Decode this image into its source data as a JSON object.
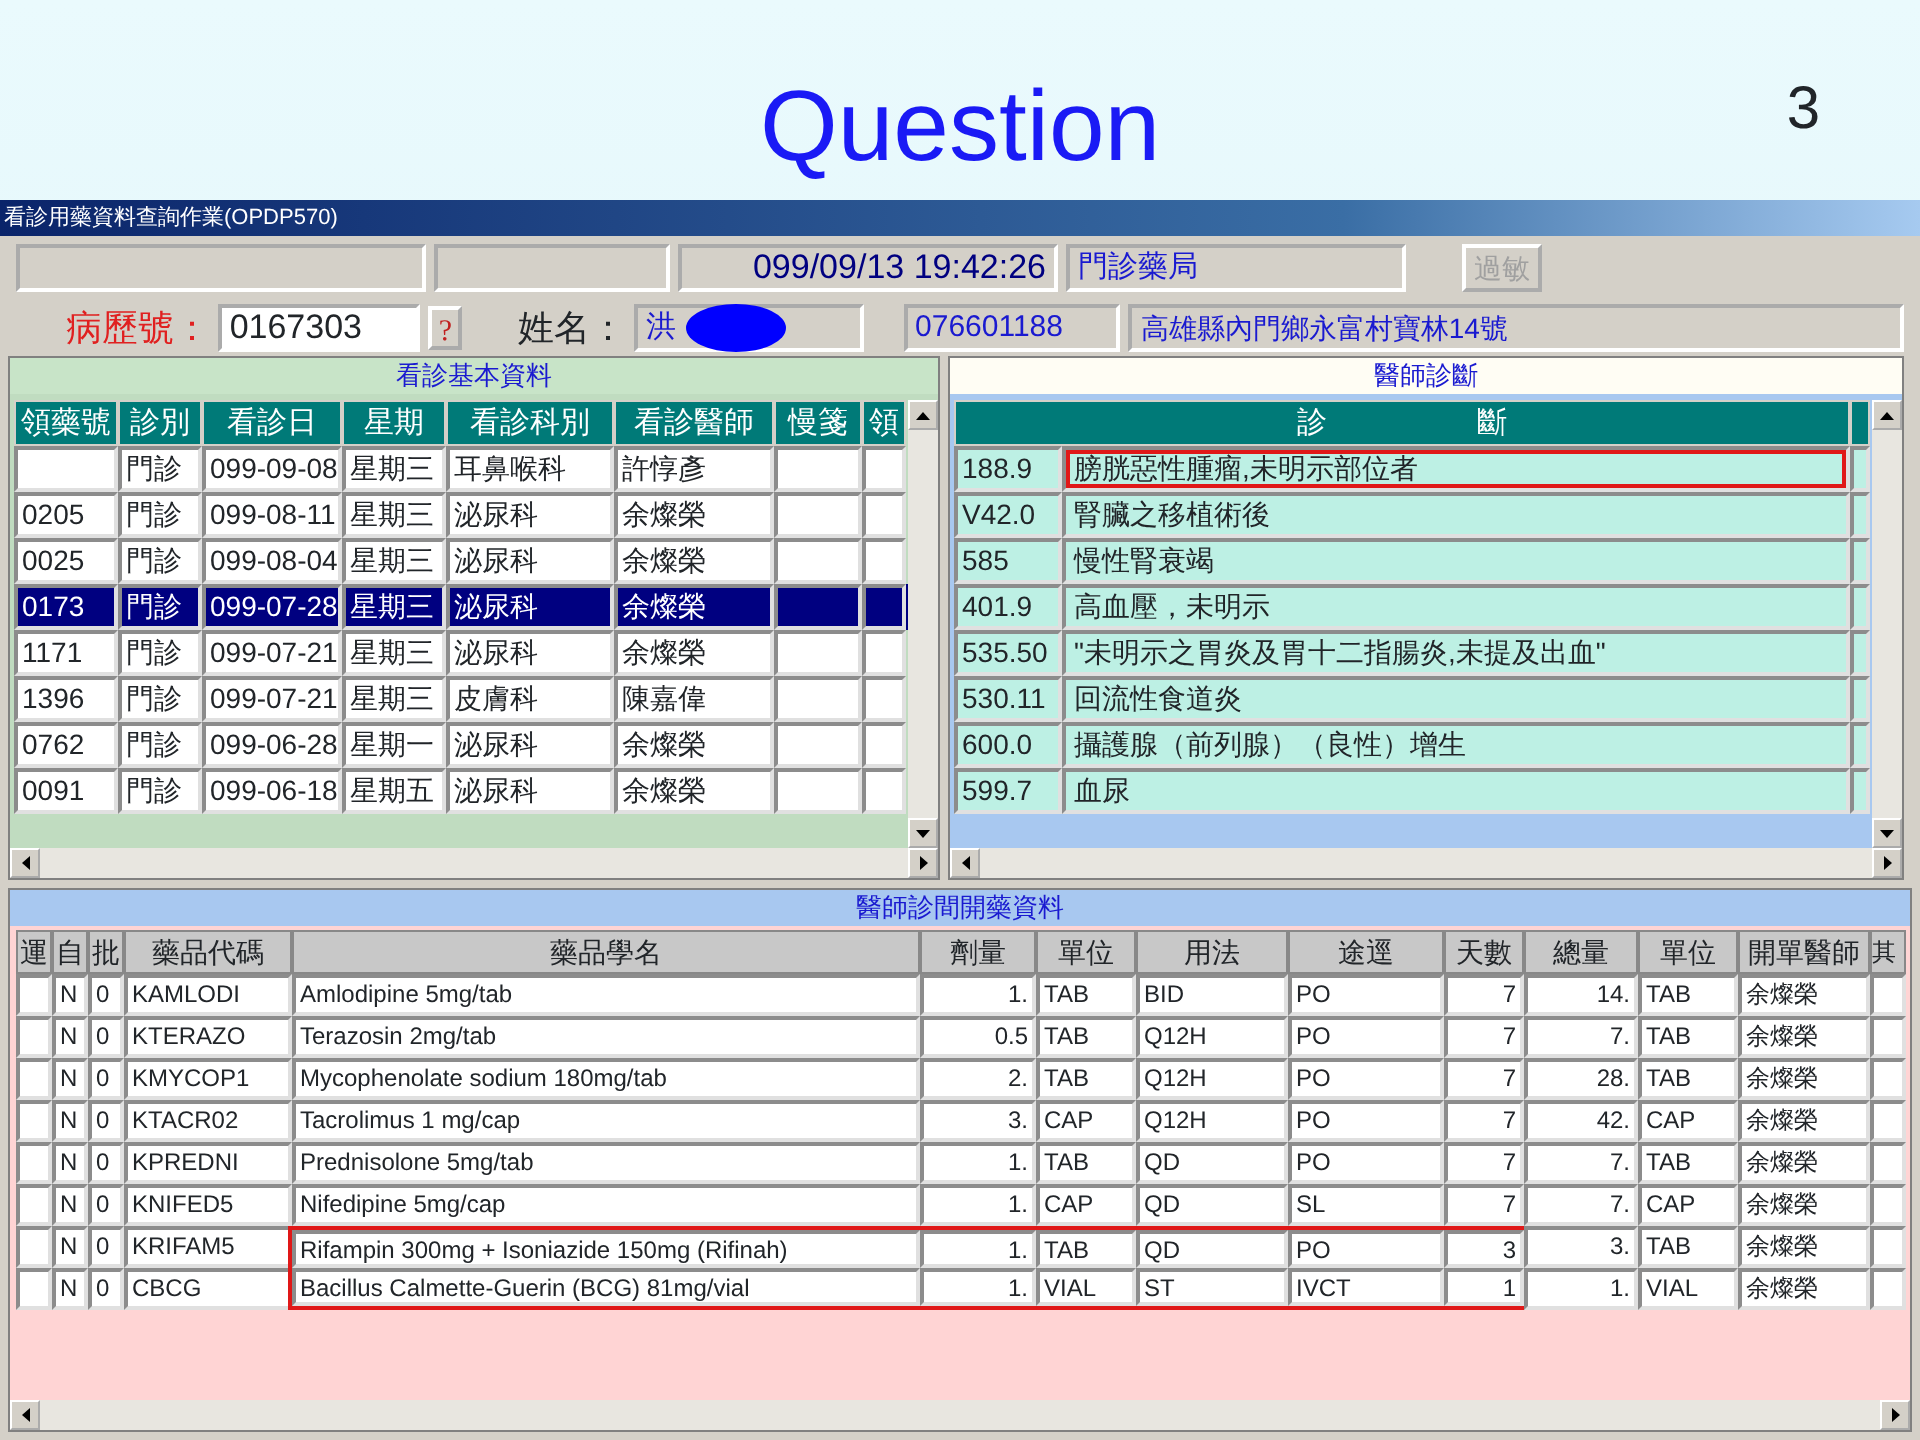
{
  "slide": {
    "title": "Question",
    "page_number": "3"
  },
  "window": {
    "title": "看診用藥資料查詢作業(OPDP570)"
  },
  "toolbar": {
    "datetime": "099/09/13  19:42:26",
    "pharmacy": "門診藥局",
    "allergy_button": {
      "label": "過敏",
      "disabled": true
    }
  },
  "patient": {
    "chart_label": "病歷號：",
    "chart_number": "0167303",
    "lookup_button": "?",
    "name_label": "姓名：",
    "name": "洪",
    "name_redacted": true,
    "phone": "076601188",
    "address": "高雄縣內門鄉永富村寶林14號"
  },
  "visits": {
    "title": "看診基本資料",
    "columns": [
      "領藥號",
      "診別",
      "看診日",
      "星期",
      "看診科別",
      "看診醫師",
      "慢箋",
      "領"
    ],
    "rows": [
      {
        "type": "門診",
        "date": "099-09-08",
        "weekday": "星期三",
        "department": "耳鼻喉科",
        "doctor": "許惇彥",
        "selected": false
      },
      {
        "number": "0205",
        "type": "門診",
        "date": "099-08-11",
        "weekday": "星期三",
        "department": "泌尿科",
        "doctor": "余燦榮",
        "selected": false
      },
      {
        "number": "0025",
        "type": "門診",
        "date": "099-08-04",
        "weekday": "星期三",
        "department": "泌尿科",
        "doctor": "余燦榮",
        "selected": false
      },
      {
        "number": "0173",
        "type": "門診",
        "date": "099-07-28",
        "weekday": "星期三",
        "department": "泌尿科",
        "doctor": "余燦榮",
        "selected": true
      },
      {
        "number": "1171",
        "type": "門診",
        "date": "099-07-21",
        "weekday": "星期三",
        "department": "泌尿科",
        "doctor": "余燦榮",
        "selected": false
      },
      {
        "number": "1396",
        "type": "門診",
        "date": "099-07-21",
        "weekday": "星期三",
        "department": "皮膚科",
        "doctor": "陳嘉偉",
        "selected": false
      },
      {
        "number": "0762",
        "type": "門診",
        "date": "099-06-28",
        "weekday": "星期一",
        "department": "泌尿科",
        "doctor": "余燦榮",
        "selected": false
      },
      {
        "number": "0091",
        "type": "門診",
        "date": "099-06-18",
        "weekday": "星期五",
        "department": "泌尿科",
        "doctor": "余燦榮",
        "selected": false
      }
    ]
  },
  "diagnoses": {
    "title": "醫師診斷",
    "heading": "診　　　　　斷",
    "rows": [
      {
        "code": "188.9",
        "text": "膀胱惡性腫瘤,未明示部位者",
        "highlighted": true
      },
      {
        "code": "V42.0",
        "text": "腎臟之移植術後",
        "highlighted": false
      },
      {
        "code": "585",
        "text": "慢性腎衰竭",
        "highlighted": false
      },
      {
        "code": "401.9",
        "text": "高血壓，未明示",
        "highlighted": false
      },
      {
        "code": "535.50",
        "text": "\"未明示之胃炎及胃十二指腸炎,未提及出血\"",
        "highlighted": false
      },
      {
        "code": "530.11",
        "text": "回流性食道炎",
        "highlighted": false
      },
      {
        "code": "600.0",
        "text": "攝護腺（前列腺）（良性）增生",
        "highlighted": false
      },
      {
        "code": "599.7",
        "text": "血尿",
        "highlighted": false
      }
    ]
  },
  "prescriptions": {
    "title": "醫師診間開藥資料",
    "columns": [
      "運",
      "自",
      "批",
      "藥品代碼",
      "藥品學名",
      "劑量",
      "單位",
      "用法",
      "途逕",
      "天數",
      "總量",
      "單位",
      "開單醫師",
      "其"
    ],
    "rows": [
      {
        "self": "N",
        "batch": "0",
        "code": "KAMLODI",
        "name": "Amlodipine 5mg/tab",
        "dose": "1.",
        "unit": "TAB",
        "usage": "BID",
        "route": "PO",
        "days": "7",
        "total": "14.",
        "total_unit": "TAB",
        "doctor": "余燦榮",
        "highlighted": false
      },
      {
        "self": "N",
        "batch": "0",
        "code": "KTERAZO",
        "name": "Terazosin 2mg/tab",
        "dose": "0.5",
        "unit": "TAB",
        "usage": "Q12H",
        "route": "PO",
        "days": "7",
        "total": "7.",
        "total_unit": "TAB",
        "doctor": "余燦榮",
        "highlighted": false
      },
      {
        "self": "N",
        "batch": "0",
        "code": "KMYCOP1",
        "name": "Mycophenolate sodium 180mg/tab",
        "dose": "2.",
        "unit": "TAB",
        "usage": "Q12H",
        "route": "PO",
        "days": "7",
        "total": "28.",
        "total_unit": "TAB",
        "doctor": "余燦榮",
        "highlighted": false
      },
      {
        "self": "N",
        "batch": "0",
        "code": "KTACR02",
        "name": "Tacrolimus 1 mg/cap",
        "dose": "3.",
        "unit": "CAP",
        "usage": "Q12H",
        "route": "PO",
        "days": "7",
        "total": "42.",
        "total_unit": "CAP",
        "doctor": "余燦榮",
        "highlighted": false
      },
      {
        "self": "N",
        "batch": "0",
        "code": "KPREDNI",
        "name": "Prednisolone 5mg/tab",
        "dose": "1.",
        "unit": "TAB",
        "usage": "QD",
        "route": "PO",
        "days": "7",
        "total": "7.",
        "total_unit": "TAB",
        "doctor": "余燦榮",
        "highlighted": false
      },
      {
        "self": "N",
        "batch": "0",
        "code": "KNIFED5",
        "name": "Nifedipine 5mg/cap",
        "dose": "1.",
        "unit": "CAP",
        "usage": "QD",
        "route": "SL",
        "days": "7",
        "total": "7.",
        "total_unit": "CAP",
        "doctor": "余燦榮",
        "highlighted": false
      },
      {
        "self": "N",
        "batch": "0",
        "code": "KRIFAM5",
        "name": "Rifampin 300mg + Isoniazide 150mg (Rifinah)",
        "dose": "1.",
        "unit": "TAB",
        "usage": "QD",
        "route": "PO",
        "days": "3",
        "total": "3.",
        "total_unit": "TAB",
        "doctor": "余燦榮",
        "highlighted": true
      },
      {
        "self": "N",
        "batch": "0",
        "code": "CBCG",
        "name": "Bacillus Calmette-Guerin (BCG) 81mg/vial",
        "dose": "1.",
        "unit": "VIAL",
        "usage": "ST",
        "route": "IVCT",
        "days": "1",
        "total": "1.",
        "total_unit": "VIAL",
        "doctor": "余燦榮",
        "highlighted": true
      }
    ]
  }
}
